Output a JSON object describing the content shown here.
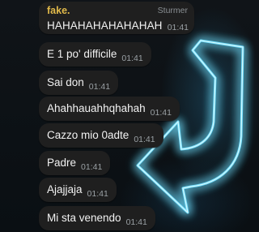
{
  "chat": {
    "first_message": {
      "sender": "fake.",
      "tag": "Sturmer",
      "text": "HAHAHAHAHAHAHAH",
      "time": "01:41"
    },
    "messages": [
      {
        "text": "E 1 po' difficile",
        "time": "01:41"
      },
      {
        "text": "Sai don",
        "time": "01:41"
      },
      {
        "text": "Ahahhauahhqhahah",
        "time": "01:41"
      },
      {
        "text": "Cazzo mio 0adte",
        "time": "01:41"
      },
      {
        "text": "Padre",
        "time": "01:41"
      },
      {
        "text": "Ajajjaja",
        "time": "01:41"
      },
      {
        "text": "Mi sta venendo",
        "time": "01:41"
      }
    ]
  },
  "colors": {
    "bubble": "#1f1f1f",
    "sender_name": "#e0b94a",
    "neon": "#4fd4ff"
  },
  "wallpaper": {
    "icon": "neon-down-left-arrow-icon"
  }
}
